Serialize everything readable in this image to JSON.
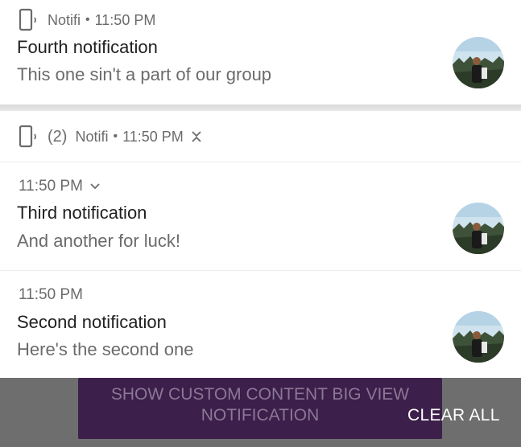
{
  "notifications": {
    "single": {
      "app_name": "Notifi",
      "time": "11:50 PM",
      "title": "Fourth notification",
      "body": "This one sin't a part of our group"
    },
    "group": {
      "count": "(2)",
      "app_name": "Notifi",
      "time": "11:50 PM",
      "items": [
        {
          "time": "11:50 PM",
          "title": "Third notification",
          "body": "And another for luck!"
        },
        {
          "time": "11:50 PM",
          "title": "Second notification",
          "body": "Here's the second one"
        }
      ]
    }
  },
  "background_app": {
    "button_label": "SHOW CUSTOM CONTENT BIG VIEW NOTIFICATION"
  },
  "shade": {
    "clear_all_label": "CLEAR ALL"
  },
  "colors": {
    "card": "#ffffff",
    "scrim": "#6e6e6e",
    "button_bg": "#3c1f4a"
  }
}
